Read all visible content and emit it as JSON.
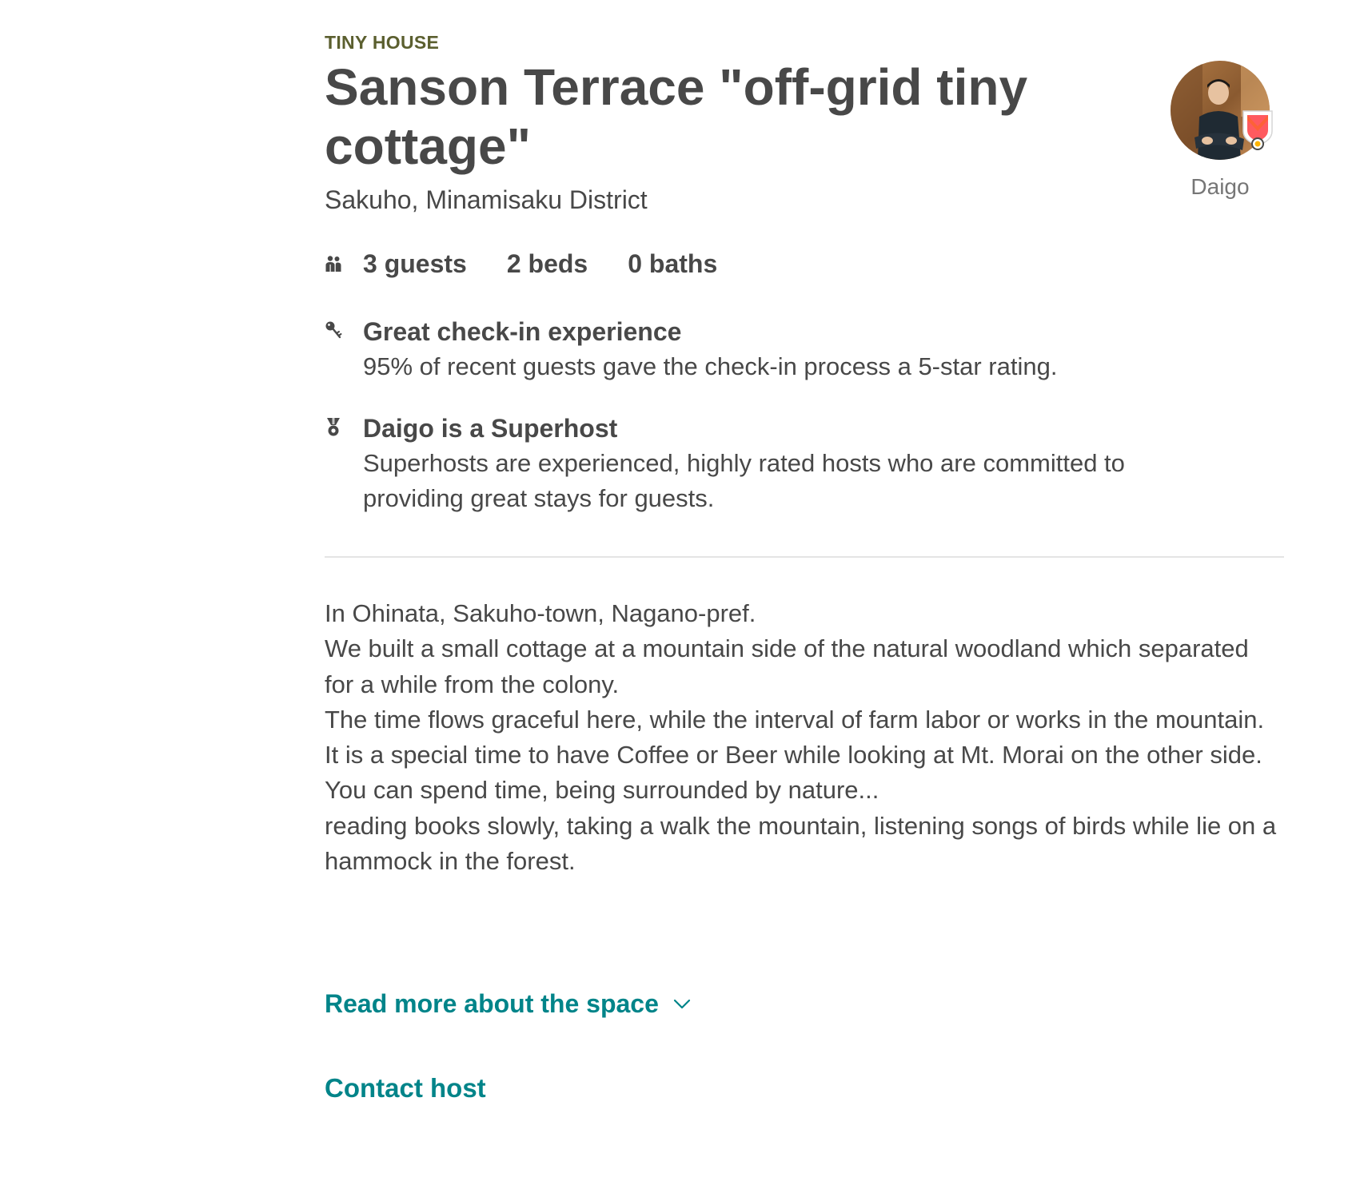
{
  "listing": {
    "category": "TINY HOUSE",
    "title": "Sanson Terrace \"off-grid tiny cottage\"",
    "location": "Sakuho, Minamisaku District"
  },
  "host": {
    "name": "Daigo",
    "avatar_icon": "host-avatar-photo",
    "badge_icon": "superhost-badge-icon"
  },
  "stats": {
    "icon": "guests-icon",
    "guests": "3 guests",
    "beds": "2 beds",
    "baths": "0 baths"
  },
  "highlights": [
    {
      "icon": "key-icon",
      "title": "Great check-in experience",
      "description": "95% of recent guests gave the check-in process a 5-star rating."
    },
    {
      "icon": "medal-icon",
      "title": "Daigo is a Superhost",
      "description": "Superhosts are experienced, highly rated hosts who are committed to providing great stays for guests."
    }
  ],
  "description": {
    "lines": [
      "In Ohinata, Sakuho-town, Nagano-pref.",
      "We built a small cottage at a mountain side of the natural woodland which separated for a while from the colony.",
      "The time flows graceful here, while the interval of farm labor or works in the mountain.",
      "It is a special time to have Coffee or Beer while looking at Mt. Morai on the other side.",
      "You can spend time, being surrounded by nature...",
      "reading books slowly, taking a walk the mountain, listening songs of birds while lie on a hammock in the forest."
    ]
  },
  "actions": {
    "read_more": "Read more about the space",
    "read_more_icon": "chevron-down-icon",
    "contact_host": "Contact host"
  },
  "colors": {
    "text": "#484848",
    "category": "#5b5f2f",
    "link": "#008489",
    "muted": "#767676",
    "divider": "#e4e4e4"
  }
}
